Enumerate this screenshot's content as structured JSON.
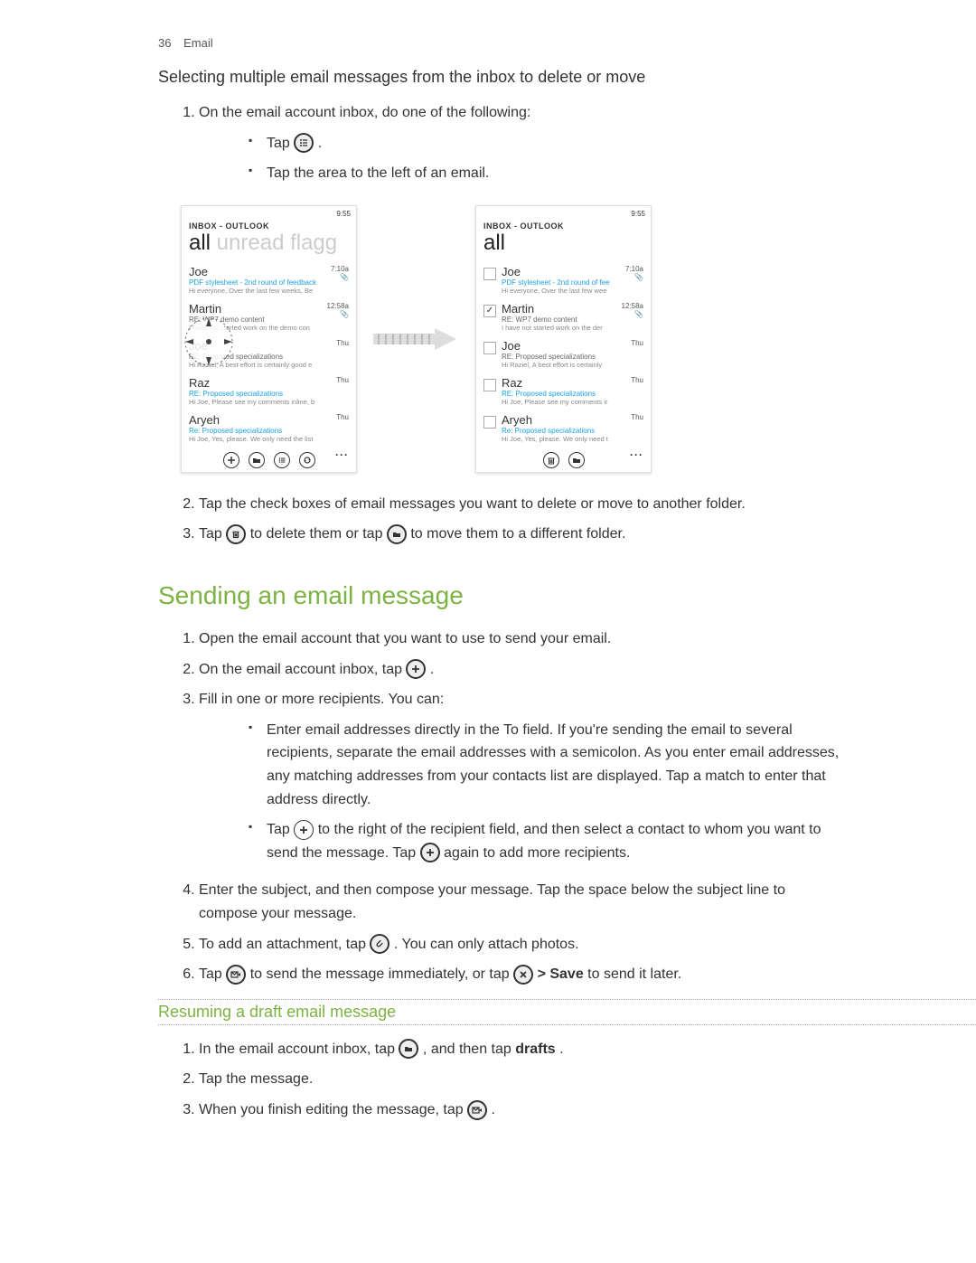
{
  "header": {
    "page_num": "36",
    "section": "Email"
  },
  "h3_selecting": "Selecting multiple email messages from the inbox to delete or move",
  "sel_step1": "On the email account inbox, do one of the following:",
  "sel_step1_b1_pre": "Tap ",
  "sel_step1_b1_post": ".",
  "sel_step1_b2": "Tap the area to the left of an email.",
  "sel_step2": "Tap the check boxes of email messages you want to delete or move to another folder.",
  "sel_step3_pre": "Tap ",
  "sel_step3_mid": " to delete them or tap ",
  "sel_step3_post": " to move them to a different folder.",
  "h2_sending": "Sending an email message",
  "send_step1": "Open the email account that you want to use to send your email.",
  "send_step2_pre": "On the email account inbox, tap ",
  "send_step2_post": ".",
  "send_step3": "Fill in one or more recipients. You can:",
  "send_step3_b1": "Enter email addresses directly in the To field. If you're sending the email to several recipients, separate the email addresses with a semicolon. As you enter email addresses, any matching addresses from your contacts list are displayed. Tap a match to enter that address directly.",
  "send_step3_b2_pre": "Tap ",
  "send_step3_b2_mid": " to the right of the recipient field, and then select a contact to whom you want to send the message. Tap ",
  "send_step3_b2_post": " again to add more recipients.",
  "send_step4": "Enter the subject, and then compose your message. Tap the space below the subject line to compose your message.",
  "send_step5_pre": "To add an attachment, tap ",
  "send_step5_post": ". You can only attach photos.",
  "send_step6_pre": "Tap ",
  "send_step6_mid": " to send the message immediately, or tap ",
  "send_step6_save": " > Save",
  "send_step6_post": " to send it later.",
  "h4_resuming": "Resuming a draft email message",
  "res_step1_pre": "In the email account inbox, tap ",
  "res_step1_mid": ", and then tap ",
  "res_step1_drafts": "drafts",
  "res_step1_post": ".",
  "res_step2": "Tap the message.",
  "res_step3_pre": "When you finish editing the message, tap ",
  "res_step3_post": ".",
  "phone": {
    "time": "9:55",
    "account": "INBOX - OUTLOOK",
    "pivot_all": "all",
    "pivot_rest": " unread flagg",
    "emails": [
      {
        "from": "Joe",
        "subject": "PDF stylesheet - 2nd round of feedback",
        "preview": "Hi everyone, Over the last few weeks, Be",
        "time": "7:10a",
        "att": true,
        "unread": true
      },
      {
        "from": "Martin",
        "subject": "RE: WP7 demo content",
        "preview": "I have not started work on the demo con",
        "time": "12:58a",
        "att": true,
        "unread": false
      },
      {
        "from": "Joe",
        "subject": "RE: Proposed specializations",
        "preview": "Hi Raziel, A best effort is certainly good e",
        "time": "Thu",
        "att": false,
        "unread": false
      },
      {
        "from": "Raz",
        "subject": "RE: Proposed specializations",
        "preview": "Hi Joe, Please see my comments inline, b",
        "time": "Thu",
        "att": false,
        "unread": true
      },
      {
        "from": "Aryeh",
        "subject": "Re: Proposed specializations",
        "preview": "Hi Joe, Yes, please. We only need the list",
        "time": "Thu",
        "att": false,
        "unread": true
      }
    ],
    "emails2": [
      {
        "from": "Joe",
        "subject": "PDF stylesheet - 2nd round of fee",
        "preview": "Hi everyone, Over the last few wee",
        "time": "7:10a",
        "att": true,
        "unread": true,
        "checked": false
      },
      {
        "from": "Martin",
        "subject": "RE: WP7 demo content",
        "preview": "I have not started work on the der",
        "time": "12:58a",
        "att": true,
        "unread": false,
        "checked": true
      },
      {
        "from": "Joe",
        "subject": "RE: Proposed specializations",
        "preview": "Hi Raziel, A best effort is certainly",
        "time": "Thu",
        "att": false,
        "unread": false,
        "checked": false
      },
      {
        "from": "Raz",
        "subject": "RE: Proposed specializations",
        "preview": "Hi Joe, Please see my comments ir",
        "time": "Thu",
        "att": false,
        "unread": true,
        "checked": false
      },
      {
        "from": "Aryeh",
        "subject": "Re: Proposed specializations",
        "preview": "Hi Joe, Yes, please. We only need t",
        "time": "Thu",
        "att": false,
        "unread": true,
        "checked": false
      }
    ]
  }
}
